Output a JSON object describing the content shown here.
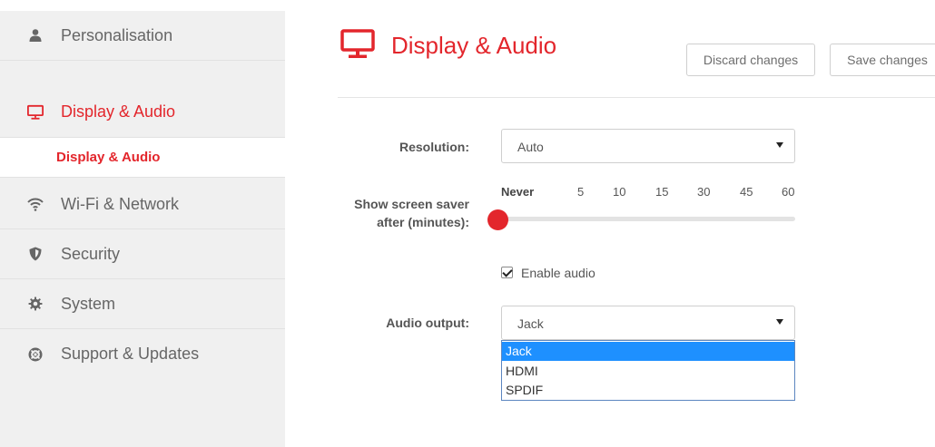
{
  "sidebar": {
    "items": [
      {
        "label": "Personalisation",
        "icon": "person-icon"
      },
      {
        "label": "Display & Audio",
        "icon": "monitor-icon",
        "active": true
      },
      {
        "label": "Wi-Fi & Network",
        "icon": "wifi-icon"
      },
      {
        "label": "Security",
        "icon": "shield-icon"
      },
      {
        "label": "System",
        "icon": "gear-icon"
      },
      {
        "label": "Support & Updates",
        "icon": "lifebuoy-icon"
      }
    ],
    "subitem": {
      "label": "Display & Audio"
    }
  },
  "header": {
    "title": "Display & Audio",
    "icon": "monitor-icon",
    "discard_label": "Discard changes",
    "save_label": "Save changes"
  },
  "form": {
    "resolution": {
      "label": "Resolution:",
      "value": "Auto"
    },
    "screensaver": {
      "label_line1": "Show screen saver",
      "label_line2": "after (minutes):",
      "ticks": [
        "Never",
        "5",
        "10",
        "15",
        "30",
        "45",
        "60"
      ],
      "selected": "Never"
    },
    "audio_enable": {
      "label": "Enable audio",
      "checked": true
    },
    "audio_output": {
      "label": "Audio output:",
      "value": "Jack",
      "options": [
        "Jack",
        "HDMI",
        "SPDIF"
      ],
      "highlighted": "Jack"
    }
  },
  "colors": {
    "accent": "#e3262c",
    "sidebar_bg": "#f0f0f0",
    "dropdown_highlight": "#1e90ff"
  }
}
